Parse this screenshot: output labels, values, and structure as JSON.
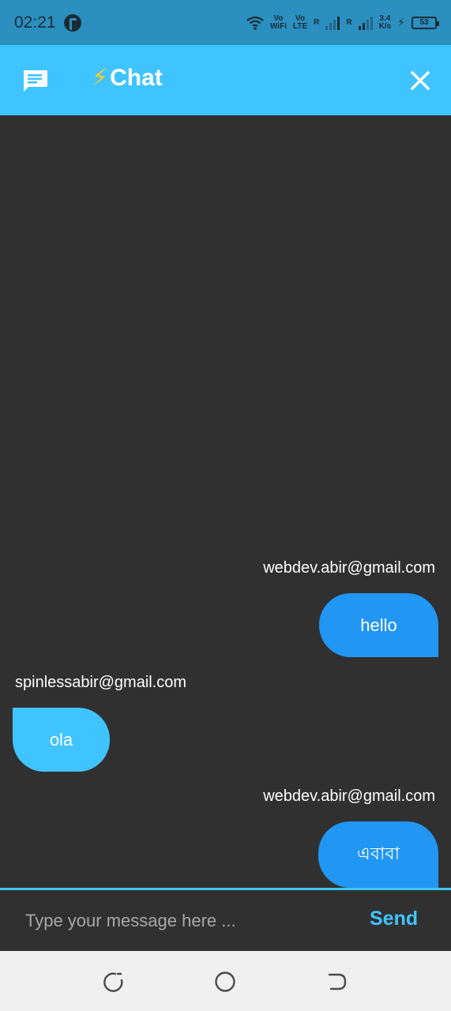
{
  "status_bar": {
    "time": "02:21",
    "wifi_label_top": "Vo",
    "wifi_label_bottom": "WiFi",
    "lte_label_top": "Vo",
    "lte_label_bottom": "LTE",
    "r1": "R",
    "r2": "R",
    "speed_top": "3.4",
    "speed_bottom": "K/s",
    "battery": "53"
  },
  "app_bar": {
    "bolt": "⚡",
    "title": "Chat"
  },
  "messages": [
    {
      "sender": "webdev.abir@gmail.com",
      "text": "hello",
      "side": "right"
    },
    {
      "sender": "spinlessabir@gmail.com",
      "text": "ola",
      "side": "left"
    },
    {
      "sender": "webdev.abir@gmail.com",
      "text": "এবাবা",
      "side": "right"
    }
  ],
  "composer": {
    "placeholder": "Type your message here ...",
    "value": "",
    "send_label": "Send"
  },
  "colors": {
    "status_bar": "#2b8fbf",
    "app_bar": "#40c4ff",
    "background": "#303030",
    "my_bubble": "#2196f3",
    "their_bubble": "#40c4ff",
    "nav_bar": "#f0f0f0"
  },
  "icons": {
    "chat": "chat-bubble-icon",
    "close": "close-icon",
    "nav_recent": "recent-apps-icon",
    "nav_home": "home-icon",
    "nav_back": "back-icon"
  }
}
